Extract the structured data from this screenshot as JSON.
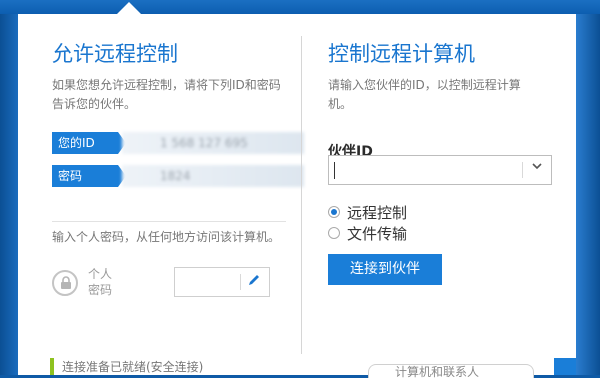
{
  "left": {
    "title": "允许远程控制",
    "desc": "如果您想允许远程控制，请将下列ID和密码告诉您的伙伴。",
    "id_label": "您的ID",
    "id_value": "1 568 127 695",
    "pwd_label": "密码",
    "pwd_value": "1824",
    "personal_desc": "输入个人密码，从任何地方访问该计算机。",
    "personal_label": "个人密码",
    "personal_input": ""
  },
  "right": {
    "title": "控制远程计算机",
    "desc": "请输入您伙伴的ID，以控制远程计算机。",
    "partner_label": "伙伴ID",
    "partner_id": "",
    "radio_remote": "远程控制",
    "radio_file": "文件传输",
    "connect_button": "连接到伙伴"
  },
  "status": {
    "text": "连接准备已就绪(安全连接)",
    "right_text": "计算机和联系人"
  },
  "icons": {
    "lock": "lock-icon",
    "pencil": "pencil-icon",
    "dropdown": "chevron-down-icon"
  },
  "colors": {
    "accent": "#1a7ed8",
    "frame": "#0e5aa6",
    "status_ok": "#8ec21f"
  }
}
